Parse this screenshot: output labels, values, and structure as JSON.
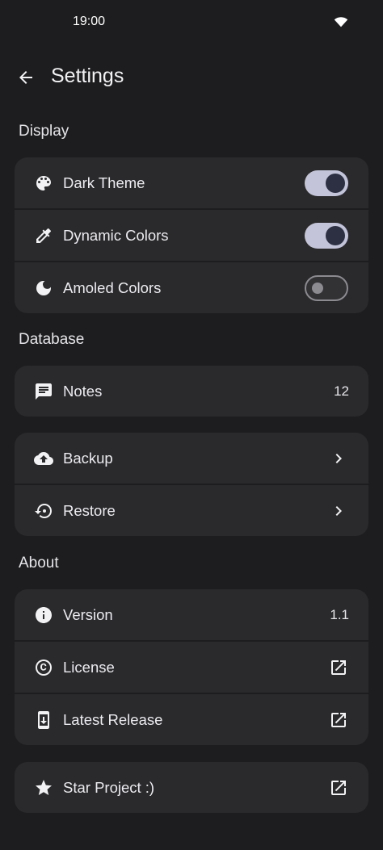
{
  "status": {
    "time": "19:00"
  },
  "header": {
    "title": "Settings"
  },
  "sections": {
    "display": "Display",
    "database": "Database",
    "about": "About"
  },
  "display": {
    "dark_theme": {
      "label": "Dark Theme",
      "enabled": true
    },
    "dynamic_colors": {
      "label": "Dynamic Colors",
      "enabled": true
    },
    "amoled_colors": {
      "label": "Amoled Colors",
      "enabled": false
    }
  },
  "database": {
    "notes": {
      "label": "Notes",
      "count": "12"
    },
    "backup": {
      "label": "Backup"
    },
    "restore": {
      "label": "Restore"
    }
  },
  "about": {
    "version": {
      "label": "Version",
      "value": "1.1"
    },
    "license": {
      "label": "License"
    },
    "latest_release": {
      "label": "Latest Release"
    }
  },
  "extra": {
    "star_project": {
      "label": "Star Project :)"
    }
  },
  "colors": {
    "background": "#1d1d1f",
    "card": "#2a2a2d",
    "switch_on_track": "#c3c4d9",
    "switch_on_knob": "#2c3042",
    "switch_off_outline": "#8b8b90"
  },
  "icons": {
    "back": "arrow-back-icon",
    "wifi": "wifi-icon",
    "dark_theme": "palette-icon",
    "dynamic_colors": "eyedropper-icon",
    "amoled_colors": "moon-icon",
    "notes": "message-icon",
    "backup": "cloud-upload-icon",
    "restore": "restore-icon",
    "version": "info-icon",
    "license": "copyright-icon",
    "latest_release": "phone-download-icon",
    "star_project": "star-icon",
    "chevron": "chevron-right-icon",
    "open_external": "open-external-icon"
  }
}
